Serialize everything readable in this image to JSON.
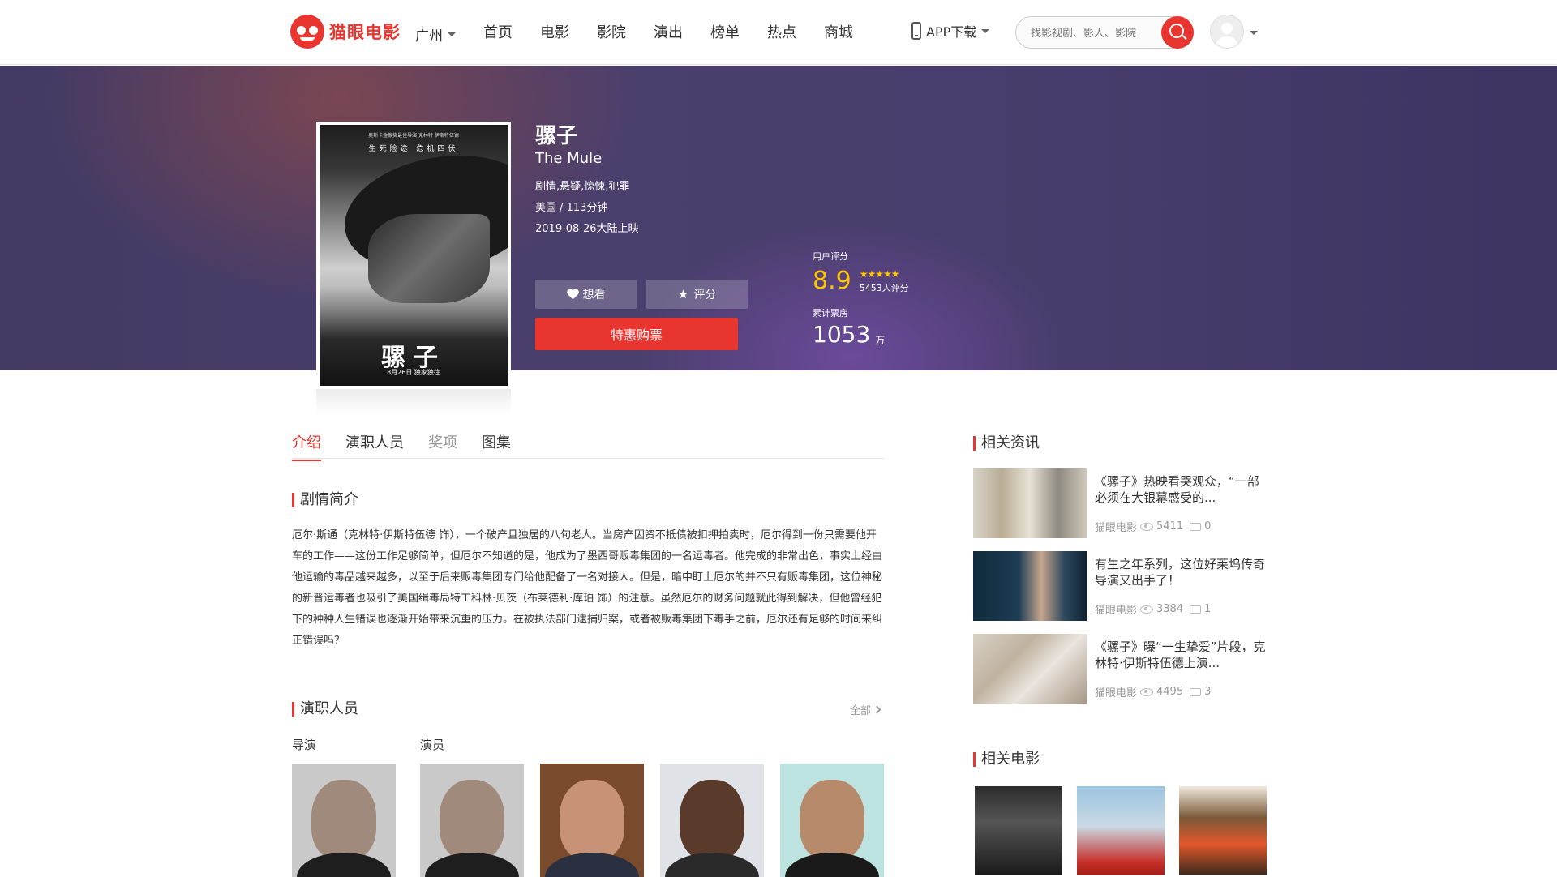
{
  "header": {
    "logo_text": "猫眼电影",
    "city": "广州",
    "nav": [
      "首页",
      "电影",
      "影院",
      "演出",
      "榜单",
      "热点",
      "商城"
    ],
    "app_download": "APP下载",
    "search_placeholder": "找影视剧、影人、影院"
  },
  "movie": {
    "title": "骡子",
    "title_en": "The Mule",
    "genres": "剧情,悬疑,惊悚,犯罪",
    "country_duration": "美国 / 113分钟",
    "release": "2019-08-26大陆上映",
    "poster": {
      "top_text": "奥斯卡金像奖最佳导演 克林特·伊斯特伍德",
      "tagline": "生死险途  危机四伏",
      "title": "骡子",
      "date": "8月26日 独家独往"
    },
    "want_label": "想看",
    "rate_label": "评分",
    "buy_label": "特惠购票",
    "user_score_label": "用户评分",
    "score": "8.9",
    "stars": "★★★★★",
    "rating_count": "5453人评分",
    "box_office_label": "累计票房",
    "box_office": "1053",
    "box_office_unit": "万"
  },
  "tabs": [
    "介绍",
    "演职人员",
    "奖项",
    "图集"
  ],
  "synopsis": {
    "heading": "剧情简介",
    "text": "厄尔·斯通（克林特·伊斯特伍德 饰），一个破产且独居的八旬老人。当房产因资不抵债被扣押拍卖时，厄尔得到一份只需要他开车的工作——这份工作足够简单，但厄尔不知道的是，他成为了墨西哥贩毒集团的一名运毒者。他完成的非常出色，事实上经由他运输的毒品越来越多，以至于后来贩毒集团专门给他配备了一名对接人。但是，暗中盯上厄尔的并不只有贩毒集团，这位神秘的新晋运毒者也吸引了美国缉毒局特工科林·贝茨（布莱德利·库珀 饰）的注意。虽然厄尔的财务问题就此得到解决，但他曾经犯下的种种人生错误也逐渐开始带来沉重的压力。在被执法部门逮捕归案，或者被贩毒集团下毒手之前，厄尔还有足够的时间来纠正错误吗？"
  },
  "cast": {
    "heading": "演职人员",
    "see_all": "全部",
    "director_label": "导演",
    "actor_label": "演员"
  },
  "news": {
    "heading": "相关资讯",
    "items": [
      {
        "title": "《骡子》热映看哭观众，“一部必须在大银幕感受的...",
        "source": "猫眼电影",
        "views": "5411",
        "comments": "0"
      },
      {
        "title": "有生之年系列，这位好莱坞传奇导演又出手了！",
        "source": "猫眼电影",
        "views": "3384",
        "comments": "1"
      },
      {
        "title": "《骡子》曝“一生挚爱”片段，克林特·伊斯特伍德上演...",
        "source": "猫眼电影",
        "views": "4495",
        "comments": "3"
      }
    ]
  },
  "related": {
    "heading": "相关电影"
  },
  "colors": {
    "brand": "#e9352f",
    "score": "#ffc600",
    "banner": "#433a63"
  }
}
